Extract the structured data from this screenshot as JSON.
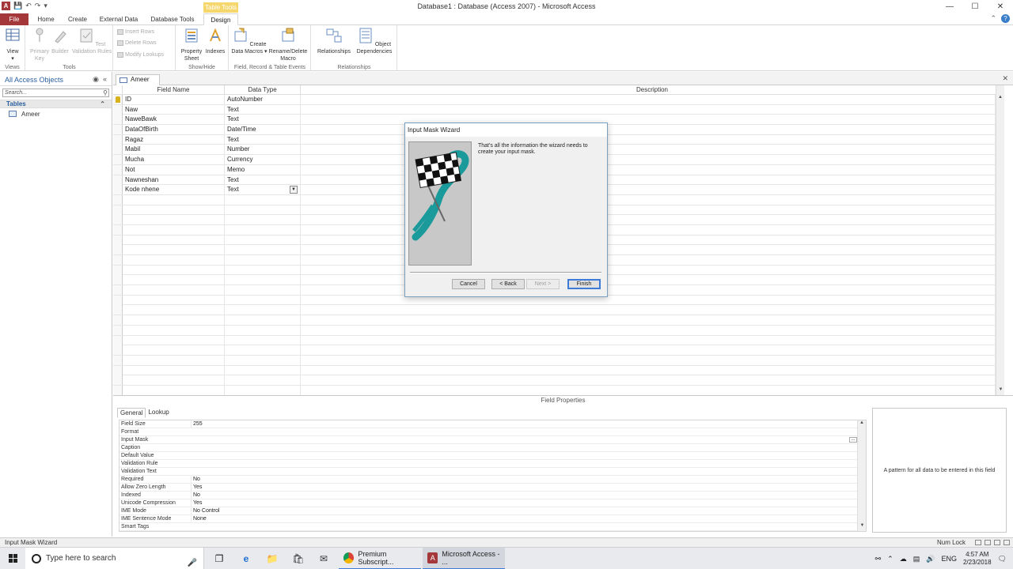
{
  "window": {
    "title": "Database1 : Database (Access 2007)  -  Microsoft Access",
    "contextual_tab": "Table Tools",
    "min": "—",
    "max": "☐",
    "close": "✕"
  },
  "tabs": [
    "File",
    "Home",
    "Create",
    "External Data",
    "Database Tools",
    "Design"
  ],
  "ribbon": {
    "views": {
      "view": "View",
      "group": "Views"
    },
    "tools": {
      "primary_key": "Primary Key",
      "builder": "Builder",
      "test_validation": "Test Validation Rules",
      "insert_rows": "Insert Rows",
      "delete_rows": "Delete Rows",
      "modify_lookups": "Modify Lookups",
      "group": "Tools"
    },
    "showhide": {
      "property_sheet": "Property Sheet",
      "indexes": "Indexes",
      "group": "Show/Hide"
    },
    "events": {
      "create_data_macros": "Create Data Macros ▾",
      "rename_delete_macro": "Rename/Delete Macro",
      "group": "Field, Record & Table Events"
    },
    "relationships": {
      "relationships": "Relationships",
      "object_dependencies": "Object Dependencies",
      "group": "Relationships"
    }
  },
  "nav": {
    "header": "All Access Objects",
    "search_placeholder": "Search...",
    "group": "Tables",
    "items": [
      "Ameer"
    ]
  },
  "doc": {
    "tab": "Ameer",
    "columns": [
      "Field Name",
      "Data Type",
      "Description"
    ],
    "rows": [
      {
        "name": "ID",
        "type": "AutoNumber"
      },
      {
        "name": "Naw",
        "type": "Text"
      },
      {
        "name": "NaweBawk",
        "type": "Text"
      },
      {
        "name": "DataOfBirth",
        "type": "Date/Time"
      },
      {
        "name": "Ragaz",
        "type": "Text"
      },
      {
        "name": "Mabil",
        "type": "Number"
      },
      {
        "name": "Mucha",
        "type": "Currency"
      },
      {
        "name": "Not",
        "type": "Memo"
      },
      {
        "name": "Nawneshan",
        "type": "Text"
      },
      {
        "name": "Kode nhene",
        "type": "Text"
      }
    ]
  },
  "field_properties": {
    "title": "Field Properties",
    "tabs": [
      "General",
      "Lookup"
    ],
    "rows": [
      {
        "label": "Field Size",
        "value": "255"
      },
      {
        "label": "Format",
        "value": ""
      },
      {
        "label": "Input Mask",
        "value": ""
      },
      {
        "label": "Caption",
        "value": ""
      },
      {
        "label": "Default Value",
        "value": ""
      },
      {
        "label": "Validation Rule",
        "value": ""
      },
      {
        "label": "Validation Text",
        "value": ""
      },
      {
        "label": "Required",
        "value": "No"
      },
      {
        "label": "Allow Zero Length",
        "value": "Yes"
      },
      {
        "label": "Indexed",
        "value": "No"
      },
      {
        "label": "Unicode Compression",
        "value": "Yes"
      },
      {
        "label": "IME Mode",
        "value": "No Control"
      },
      {
        "label": "IME Sentence Mode",
        "value": "None"
      },
      {
        "label": "Smart Tags",
        "value": ""
      }
    ],
    "help": "A pattern for all data to be entered in this field"
  },
  "wizard": {
    "title": "Input Mask Wizard",
    "message": "That's all the information the wizard needs to create your input mask.",
    "cancel": "Cancel",
    "back": "< Back",
    "next": "Next >",
    "finish": "Finish"
  },
  "status": {
    "left": "Input Mask Wizard",
    "right": "Num Lock"
  },
  "taskbar": {
    "search_placeholder": "Type here to search",
    "apps": [
      "Premium Subscript...",
      "Microsoft Access - ..."
    ],
    "lang": "ENG",
    "time": "4:57 AM",
    "date": "2/23/2018"
  },
  "colors": {
    "file_tab": "#a4373a",
    "accent": "#3d7bd6",
    "contextual": "#f5d76e"
  }
}
